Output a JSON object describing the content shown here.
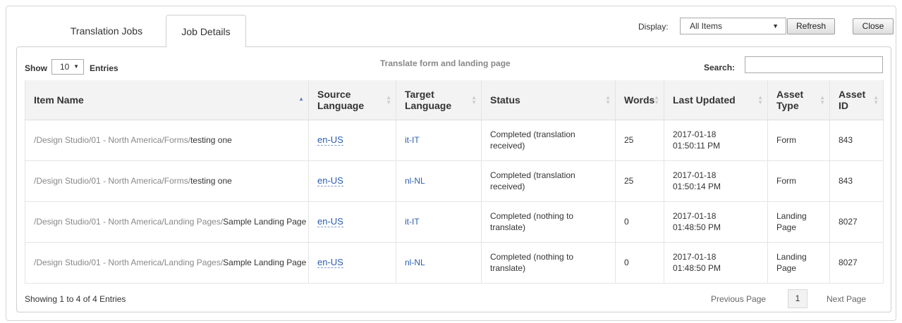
{
  "tabs": {
    "jobs_label": "Translation Jobs",
    "details_label": "Job Details"
  },
  "toolbar": {
    "display_label": "Display:",
    "display_value": "All Items",
    "refresh_label": "Refresh",
    "close_label": "Close"
  },
  "controls": {
    "show_label": "Show",
    "show_value": "10",
    "entries_label": "Entries",
    "job_title": "Translate form and landing page",
    "search_label": "Search:",
    "search_value": ""
  },
  "table": {
    "headers": {
      "item_name": "Item Name",
      "source_line1": "Source",
      "source_line2": "Language",
      "target_line1": "Target",
      "target_line2": "Language",
      "status": "Status",
      "words": "Words",
      "last_updated": "Last Updated",
      "asset_type_line1": "Asset",
      "asset_type_line2": "Type",
      "asset_id_line1": "Asset",
      "asset_id_line2": "ID"
    },
    "rows": [
      {
        "path": "/Design Studio/01 - North America/Forms/",
        "name": "testing one",
        "source": "en-US",
        "target": "it-IT",
        "status_line1": "Completed (translation",
        "status_line2": "received)",
        "words": "25",
        "updated_date": "2017-01-18",
        "updated_time": "01:50:11 PM",
        "asset_type_line1": "Form",
        "asset_type_line2": "",
        "asset_id": "843"
      },
      {
        "path": "/Design Studio/01 - North America/Forms/",
        "name": "testing one",
        "source": "en-US",
        "target": "nl-NL",
        "status_line1": "Completed (translation",
        "status_line2": "received)",
        "words": "25",
        "updated_date": "2017-01-18",
        "updated_time": "01:50:14 PM",
        "asset_type_line1": "Form",
        "asset_type_line2": "",
        "asset_id": "843"
      },
      {
        "path": "/Design Studio/01 - North America/Landing Pages/",
        "name": "Sample Landing Page",
        "source": "en-US",
        "target": "it-IT",
        "status_line1": "Completed (nothing to",
        "status_line2": "translate)",
        "words": "0",
        "updated_date": "2017-01-18",
        "updated_time": "01:48:50 PM",
        "asset_type_line1": "Landing",
        "asset_type_line2": "Page",
        "asset_id": "8027"
      },
      {
        "path": "/Design Studio/01 - North America/Landing Pages/",
        "name": "Sample Landing Page",
        "source": "en-US",
        "target": "nl-NL",
        "status_line1": "Completed (nothing to",
        "status_line2": "translate)",
        "words": "0",
        "updated_date": "2017-01-18",
        "updated_time": "01:48:50 PM",
        "asset_type_line1": "Landing",
        "asset_type_line2": "Page",
        "asset_id": "8027"
      }
    ]
  },
  "footer": {
    "showing_text": "Showing 1 to 4 of 4 Entries",
    "prev_label": "Previous Page",
    "page_number": "1",
    "next_label": "Next Page"
  },
  "icons": {
    "select_caret": "▼",
    "sort_asc_active": "▲",
    "sort_both": "sort-icon"
  },
  "colors": {
    "link": "#2a5db0",
    "path_gray": "#888888",
    "header_bg": "#f3f3f3"
  }
}
